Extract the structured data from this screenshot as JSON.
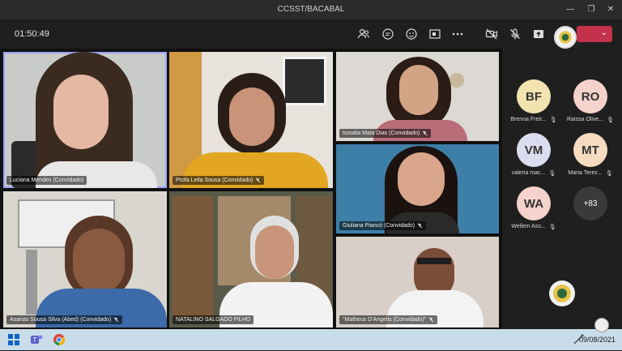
{
  "window": {
    "title": "CCSST/BACABAL"
  },
  "toolbar": {
    "timer": "01:50:49",
    "icons": [
      "people-icon",
      "chat-icon",
      "reactions-icon",
      "share-tray-icon",
      "more-icon",
      "camera-off-icon",
      "mic-off-icon",
      "share-icon"
    ]
  },
  "tiles": [
    {
      "name": "Luciana Mendes (Convidado)",
      "muted": false
    },
    {
      "name": "Profa Leila Sousa (Convidado)",
      "muted": true
    },
    {
      "name": "Ismalia Maia Dias (Convidado)",
      "muted": true
    },
    {
      "name": "Giuliana Piancó (Convidado)",
      "muted": true
    },
    {
      "name": "Asarias Sousa Silva (Abed) (Convidado)",
      "muted": true
    },
    {
      "name": "NATALINO SALGADO FILHO",
      "muted": false
    },
    {
      "name": "\"Matheus D'Angelis (Convidado)\"",
      "muted": true
    }
  ],
  "participants": [
    {
      "initials": "BF",
      "name": "Brenna Freir...",
      "color": "#f3e3b0"
    },
    {
      "initials": "RO",
      "name": "Raissa Olive...",
      "color": "#f5d2cc"
    },
    {
      "initials": "VM",
      "name": "valeria mac...",
      "color": "#dcdcf0"
    },
    {
      "initials": "MT",
      "name": "Maria Terez...",
      "color": "#f5dcc0"
    },
    {
      "initials": "WA",
      "name": "Wellem Ass...",
      "color": "#f5d2cc"
    }
  ],
  "more_count": "+83",
  "taskbar": {
    "date": "09/08/2021"
  }
}
